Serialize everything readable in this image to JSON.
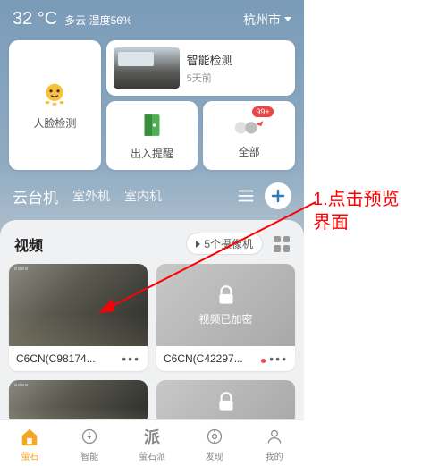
{
  "topbar": {
    "temperature": "32 °C",
    "weather_text": "多云 湿度56%",
    "city": "杭州市"
  },
  "cards": {
    "face_detect": "人脸检测",
    "smart_detect_title": "智能检测",
    "smart_detect_time": "5天前",
    "entry_alert": "出入提醒",
    "all": "全部",
    "badge_count": "99+"
  },
  "tabs": {
    "ptz": "云台机",
    "outdoor": "室外机",
    "indoor": "室内机"
  },
  "video": {
    "title": "视频",
    "camera_count": "5个摄像机",
    "encrypted": "视频已加密",
    "items": [
      {
        "name": "C6CN(C98174..."
      },
      {
        "name": "C6CN(C42297..."
      }
    ]
  },
  "bottomnav": {
    "ys": "萤石",
    "smart": "智能",
    "ysp": "萤石派",
    "discover": "发现",
    "mine": "我的"
  },
  "annotation": {
    "line1": "1.点击预览",
    "line2": "界面"
  }
}
